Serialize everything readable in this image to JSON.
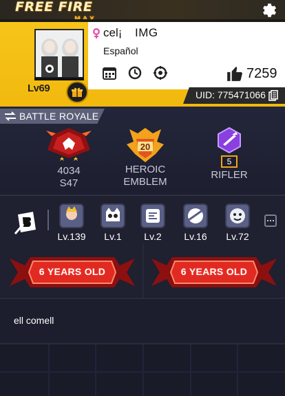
{
  "header": {
    "logo_text": "FREE FIRE",
    "logo_sub": "MAX",
    "settings_icon": "gear-icon",
    "accent_color": "#f2b90e"
  },
  "profile": {
    "nickname": "cel¡",
    "guild": "IMG",
    "language": "Español",
    "level": "Lv69",
    "likes": "7259",
    "uid": "UID: 775471066",
    "gender_icon": "female-icon"
  },
  "battle_royale": {
    "tab_label": "BATTLE ROYALE",
    "ranks": [
      {
        "line1": "4034",
        "line2": "S47",
        "icon": "rank-badge-icon"
      },
      {
        "line1": "HEROIC",
        "line2": "EMBLEM",
        "icon": "emblem-icon",
        "badge_value": "20"
      },
      {
        "line1": "RIFLER",
        "line2": "",
        "icon": "rifler-icon",
        "badge_value": "5"
      }
    ]
  },
  "progression": {
    "items": [
      {
        "label": "Lv.139",
        "icon": "character-icon"
      },
      {
        "label": "Lv.1",
        "icon": "pet-icon"
      },
      {
        "label": "Lv.2",
        "icon": "chip-icon"
      },
      {
        "label": "Lv.16",
        "icon": "mask-icon"
      },
      {
        "label": "Lv.72",
        "icon": "companion-icon"
      }
    ]
  },
  "badges": [
    {
      "label": "6 YEARS OLD"
    },
    {
      "label": "6 YEARS OLD"
    }
  ],
  "signature": {
    "text": "ell comell"
  }
}
